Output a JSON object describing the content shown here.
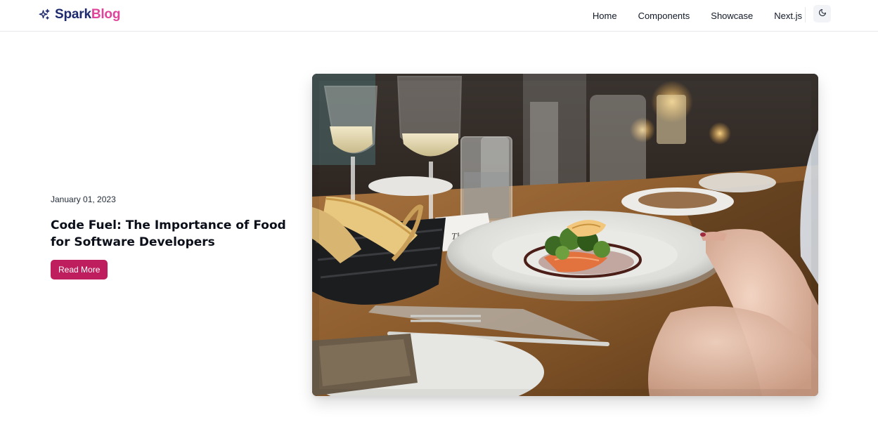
{
  "brand": {
    "name_part1": "Spark",
    "name_part2": "Blog",
    "logo_icon": "sparkles-icon",
    "color_primary": "#1e2a6e",
    "color_accent": "#e0449b"
  },
  "nav": {
    "items": [
      {
        "label": "Home"
      },
      {
        "label": "Components"
      },
      {
        "label": "Showcase"
      },
      {
        "label": "Next.js"
      }
    ],
    "theme_toggle_icon": "moon-icon"
  },
  "hero": {
    "date": "January 01, 2023",
    "title": "Code Fuel: The Importance of Food for Software Developers",
    "button_label": "Read More",
    "button_color": "#be1e5d",
    "image_subject": "restaurant-dinner-table-photo"
  }
}
